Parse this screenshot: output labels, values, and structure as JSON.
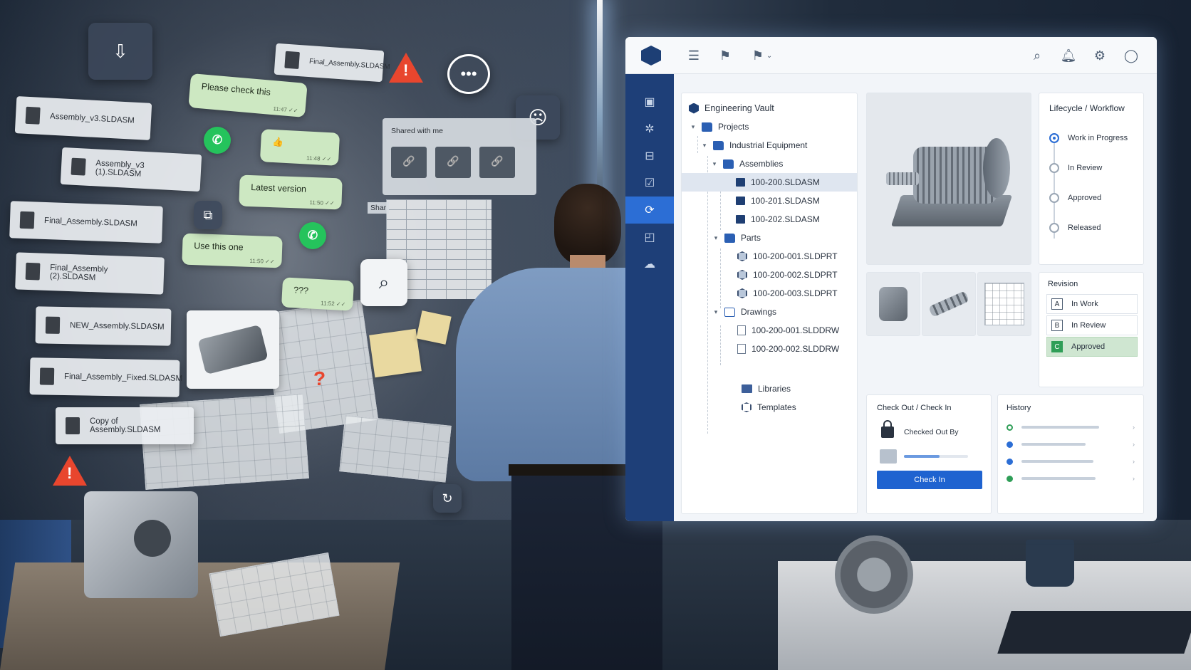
{
  "chaos": {
    "files": [
      "Assembly_v3.SLDASM",
      "Assembly_v3 (1).SLDASM",
      "Final_Assembly.SLDASM",
      "Final_Assembly (2).SLDASM",
      "NEW_Assembly.SLDASM",
      "Final_Assembly_Fixed.SLDASM",
      "Copy of Assembly.SLDASM"
    ],
    "top_file": "Final_Assembly.SLDASM",
    "chats": [
      {
        "text": "Please check this",
        "time": "11:47 ✓✓"
      },
      {
        "text": "👍",
        "time": "11:48 ✓✓"
      },
      {
        "text": "Latest version",
        "time": "11:50 ✓✓"
      },
      {
        "text": "Use this one",
        "time": "11:50 ✓✓"
      },
      {
        "text": "???",
        "time": "11:52 ✓✓"
      }
    ],
    "shared_title": "Shared with me",
    "shared_partial": "Shar"
  },
  "toolbar": {
    "icons": [
      "menu-icon",
      "flag-icon",
      "flag-dropdown-icon",
      "search-icon",
      "bell-icon",
      "gear-icon",
      "user-icon"
    ]
  },
  "sidebar": {
    "icons": [
      "document-icon",
      "component-icon",
      "package-icon",
      "checklist-icon",
      "sync-doc-icon",
      "preview-icon",
      "settings-cloud-icon"
    ],
    "active_index": 4
  },
  "tree": {
    "root": "Engineering Vault",
    "projects": "Projects",
    "industrial_equipment": "Industrial Equipment",
    "assemblies": "Assemblies",
    "asm_files": [
      "100-200.SLDASM",
      "100-201.SLDASM",
      "100-202.SLDASM"
    ],
    "parts": "Parts",
    "part_files": [
      "100-200-001.SLDPRT",
      "100-200-002.SLDPRT",
      "100-200-003.SLDPRT"
    ],
    "drawings": "Drawings",
    "drawing_files": [
      "100-200-001.SLDDRW",
      "100-200-002.SLDDRW"
    ],
    "libraries": "Libraries",
    "templates": "Templates"
  },
  "lifecycle": {
    "title": "Lifecycle / Workflow",
    "steps": [
      "Work in Progress",
      "In Review",
      "Approved",
      "Released"
    ],
    "active_index": 0
  },
  "revision": {
    "title": "Revision",
    "rows": [
      {
        "letter": "A",
        "label": "In Work"
      },
      {
        "letter": "B",
        "label": "In Review"
      },
      {
        "letter": "C",
        "label": "Approved"
      }
    ]
  },
  "checkout": {
    "title": "Check Out / Check In",
    "checked_out_by": "Checked Out By",
    "progress": 0.55,
    "button": "Check In"
  },
  "history": {
    "title": "History",
    "entries": [
      {
        "status": "open",
        "fill": 0.78
      },
      {
        "status": "blue",
        "fill": 0.64
      },
      {
        "status": "blue",
        "fill": 0.72
      },
      {
        "status": "green",
        "fill": 0.74
      }
    ]
  },
  "colors": {
    "sidebar": "#1e3f78",
    "accent": "#2c6ed5",
    "approved": "#cfe6d1",
    "warning": "#e8462e",
    "whatsapp": "#25c35c"
  }
}
